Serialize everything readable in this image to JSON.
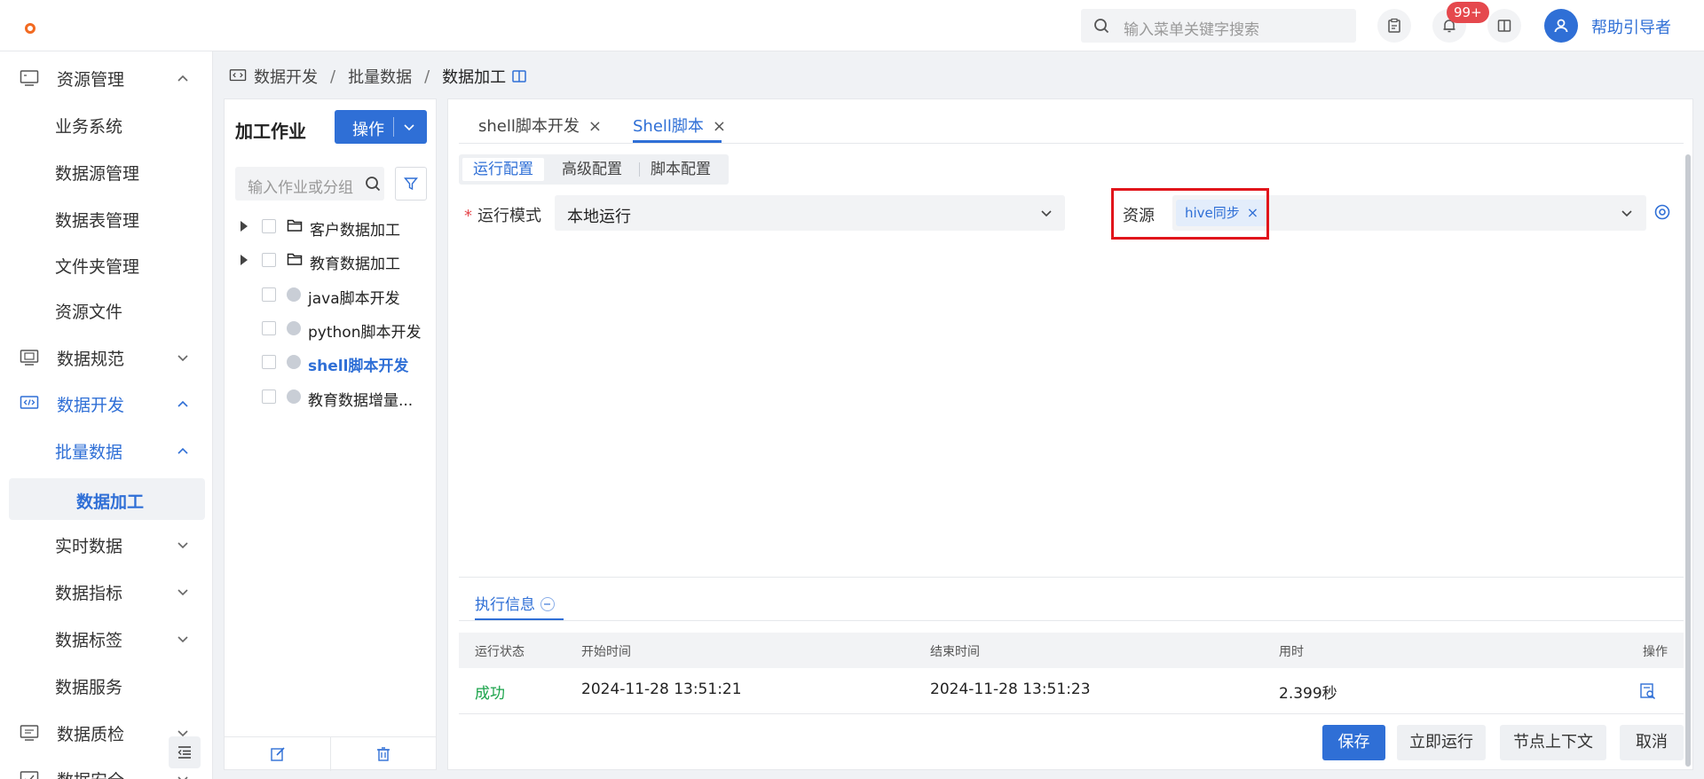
{
  "topbar": {
    "search_placeholder": "输入菜单关键字搜索",
    "notification_count": "99+",
    "user_name": "帮助引导者"
  },
  "breadcrumb": {
    "items": [
      "数据开发",
      "批量数据",
      "数据加工"
    ],
    "separator": "/"
  },
  "sidebar": {
    "items": [
      {
        "label": "资源管理"
      },
      {
        "label": "业务系统"
      },
      {
        "label": "数据源管理"
      },
      {
        "label": "数据表管理"
      },
      {
        "label": "文件夹管理"
      },
      {
        "label": "资源文件"
      },
      {
        "label": "数据规范"
      },
      {
        "label": "数据开发"
      },
      {
        "label": "批量数据"
      },
      {
        "label": "数据加工"
      },
      {
        "label": "实时数据"
      },
      {
        "label": "数据指标"
      },
      {
        "label": "数据标签"
      },
      {
        "label": "数据服务"
      },
      {
        "label": "数据质检"
      },
      {
        "label": "数据安全"
      }
    ]
  },
  "job_panel": {
    "title": "加工作业",
    "operation_label": "操作",
    "search_placeholder": "输入作业或分组",
    "tree": [
      {
        "label": "客户数据加工",
        "type": "folder"
      },
      {
        "label": "教育数据加工",
        "type": "folder"
      },
      {
        "label": "java脚本开发",
        "type": "file"
      },
      {
        "label": "python脚本开发",
        "type": "file"
      },
      {
        "label": "shell脚本开发",
        "type": "file",
        "selected": true
      },
      {
        "label": "教育数据增量..."
      }
    ]
  },
  "main": {
    "tabs": [
      {
        "label": "shell脚本开发",
        "close": "×"
      },
      {
        "label": "Shell脚本",
        "close": "×",
        "active": true
      }
    ],
    "config_tabs": [
      "运行配置",
      "高级配置",
      "脚本配置"
    ],
    "run_mode": {
      "required_mark": "*",
      "label": "运行模式",
      "value": "本地运行"
    },
    "resource": {
      "label": "资源",
      "tag": "hive同步",
      "tag_close": "×"
    },
    "exec_info": {
      "tab_label": "执行信息",
      "columns": [
        "运行状态",
        "开始时间",
        "结束时间",
        "用时",
        "操作"
      ],
      "rows": [
        {
          "status": "成功",
          "start": "2024-11-28 13:51:21",
          "end": "2024-11-28 13:51:23",
          "duration": "2.399秒"
        }
      ]
    },
    "buttons": {
      "save": "保存",
      "run_now": "立即运行",
      "node_context": "节点上下文",
      "cancel": "取消"
    }
  },
  "colors": {
    "accent": "#2f6fd6",
    "success": "#1aa34a",
    "badge": "#e5484d",
    "highlight": "#e1151b"
  }
}
